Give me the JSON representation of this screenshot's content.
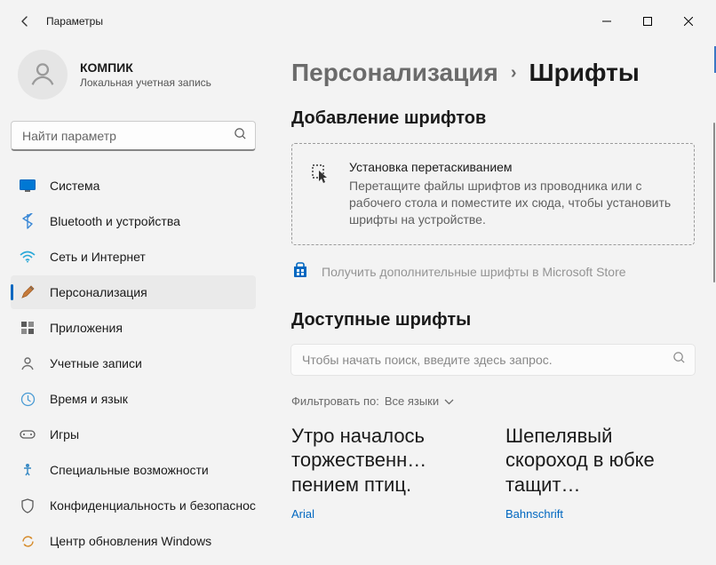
{
  "window": {
    "title": "Параметры"
  },
  "user": {
    "name": "КОМПИК",
    "subtitle": "Локальная учетная запись"
  },
  "search": {
    "placeholder": "Найти параметр"
  },
  "nav": {
    "items": [
      {
        "label": "Система"
      },
      {
        "label": "Bluetooth и устройства"
      },
      {
        "label": "Сеть и Интернет"
      },
      {
        "label": "Персонализация"
      },
      {
        "label": "Приложения"
      },
      {
        "label": "Учетные записи"
      },
      {
        "label": "Время и язык"
      },
      {
        "label": "Игры"
      },
      {
        "label": "Специальные возможности"
      },
      {
        "label": "Конфиденциальность и безопасность"
      },
      {
        "label": "Центр обновления Windows"
      }
    ],
    "active_index": 3
  },
  "breadcrumb": {
    "parent": "Персонализация",
    "current": "Шрифты"
  },
  "sections": {
    "add": {
      "heading": "Добавление шрифтов",
      "drop_title": "Установка перетаскиванием",
      "drop_sub": "Перетащите файлы шрифтов из проводника или с рабочего стола и поместите их сюда, чтобы установить шрифты на устройстве.",
      "store_link": "Получить дополнительные шрифты в Microsoft Store"
    },
    "available": {
      "heading": "Доступные шрифты",
      "search_placeholder": "Чтобы начать поиск, введите здесь запрос.",
      "filter_label": "Фильтровать по:",
      "filter_value": "Все языки",
      "cards": [
        {
          "sample": "Утро началось торжественн… пением птиц.",
          "name": "Arial"
        },
        {
          "sample": "Шепелявый скороход в юбке тащит…",
          "name": "Bahnschrift"
        }
      ]
    }
  },
  "colors": {
    "accent": "#0067c0"
  }
}
